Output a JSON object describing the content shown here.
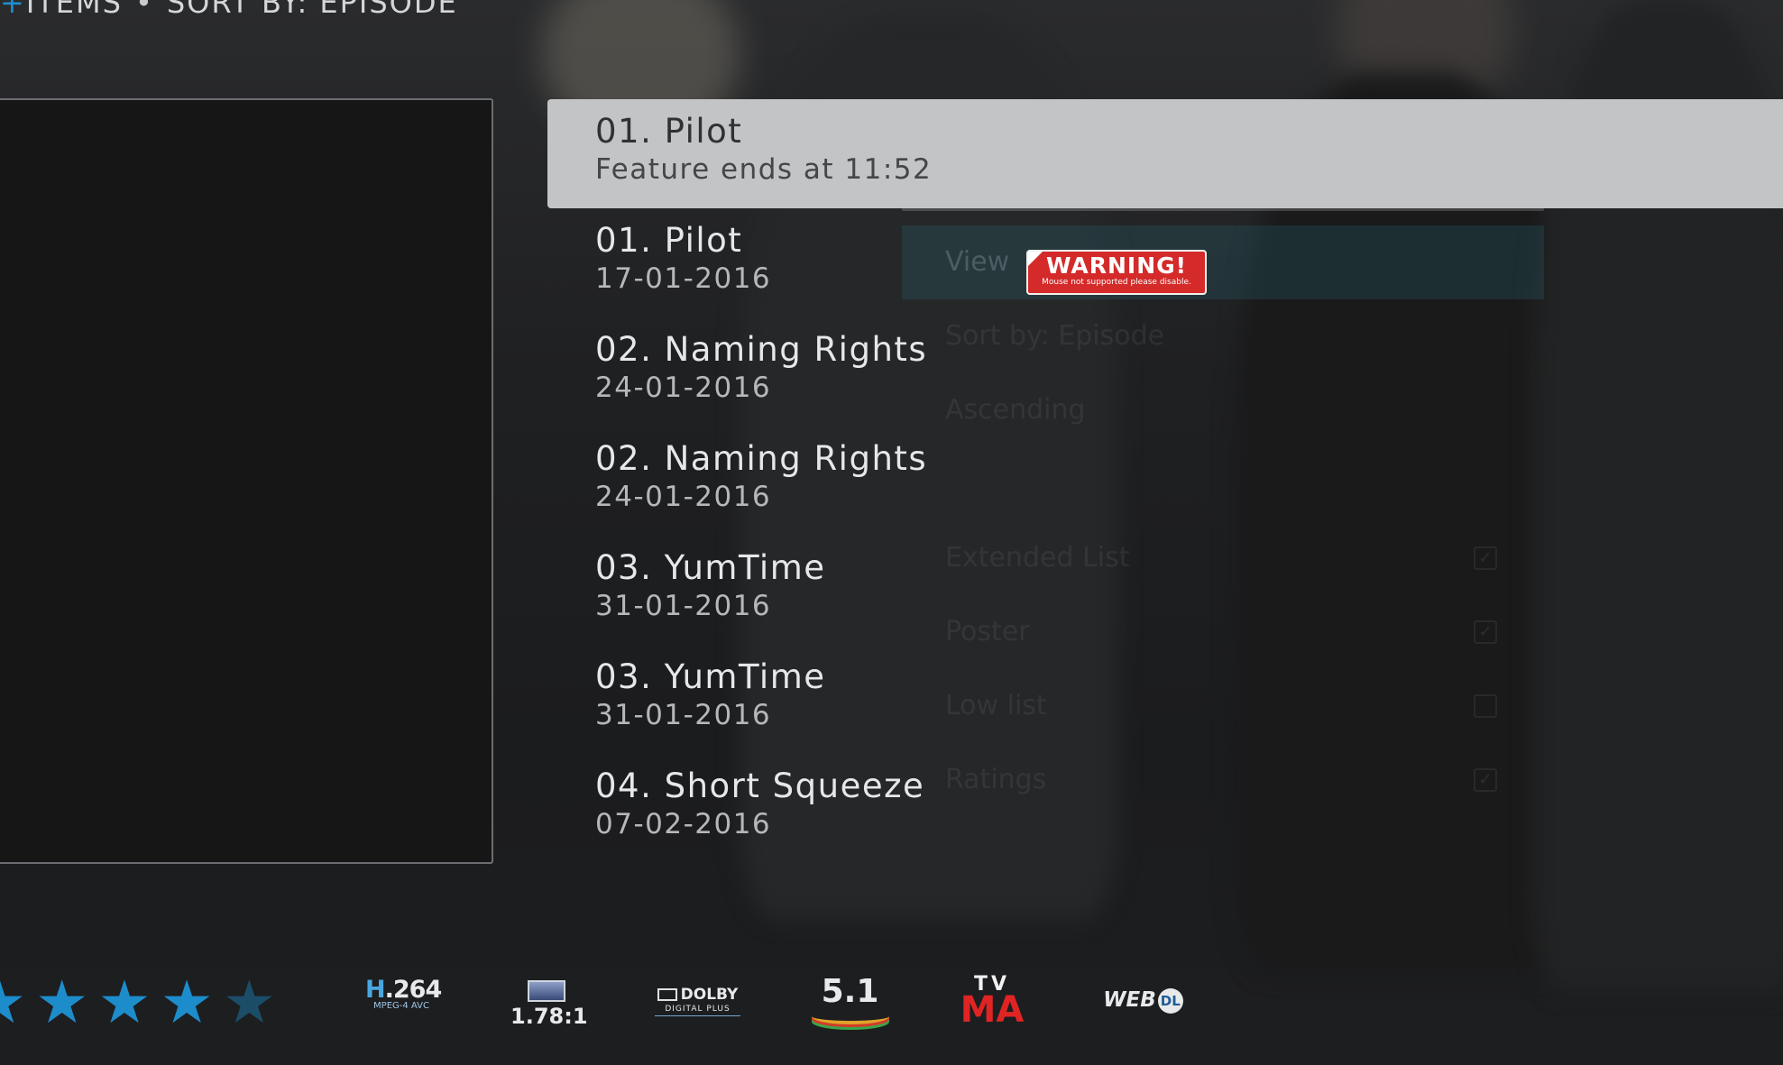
{
  "header": {
    "items_label": "ITEMS",
    "separator": "•",
    "sort_label": "SORT BY: EPISODE"
  },
  "episodes": [
    {
      "title": "01. Pilot",
      "subtitle": "Feature ends at 11:52",
      "selected": true
    },
    {
      "title": "01. Pilot",
      "subtitle": "17-01-2016"
    },
    {
      "title": "02. Naming Rights",
      "subtitle": "24-01-2016"
    },
    {
      "title": "02. Naming Rights",
      "subtitle": "24-01-2016"
    },
    {
      "title": "03. YumTime",
      "subtitle": "31-01-2016"
    },
    {
      "title": "03. YumTime",
      "subtitle": "31-01-2016"
    },
    {
      "title": "04. Short Squeeze",
      "subtitle": "07-02-2016"
    }
  ],
  "view_menu": {
    "view_label": "View",
    "rows": [
      {
        "label": "Sort by: Episode",
        "check": ""
      },
      {
        "label": "Ascending",
        "check": ""
      },
      {
        "label": "",
        "check": ""
      },
      {
        "label": "Extended List",
        "check": "✓"
      },
      {
        "label": "Poster",
        "check": "✓"
      },
      {
        "label": "Low list",
        "check": ""
      },
      {
        "label": "Ratings",
        "check": "✓"
      }
    ]
  },
  "warning": {
    "title": "WARNING!",
    "message": "Mouse not supported please disable."
  },
  "rating": {
    "stars_full": 4,
    "stars_total": 5
  },
  "media_flags": {
    "codec": "H.264",
    "codec_sub": "MPEG-4 AVC",
    "aspect": "1.78:1",
    "audio": "DOLBY",
    "audio_sub": "DIGITAL PLUS",
    "channels": "5.1",
    "rating_top": "TV",
    "rating_bottom": "MA",
    "source": "WEB",
    "source_badge": "DL"
  },
  "colors": {
    "accent": "#1d8ccb",
    "selected_row": "#c3c4c6",
    "warning": "#d42a2a"
  }
}
